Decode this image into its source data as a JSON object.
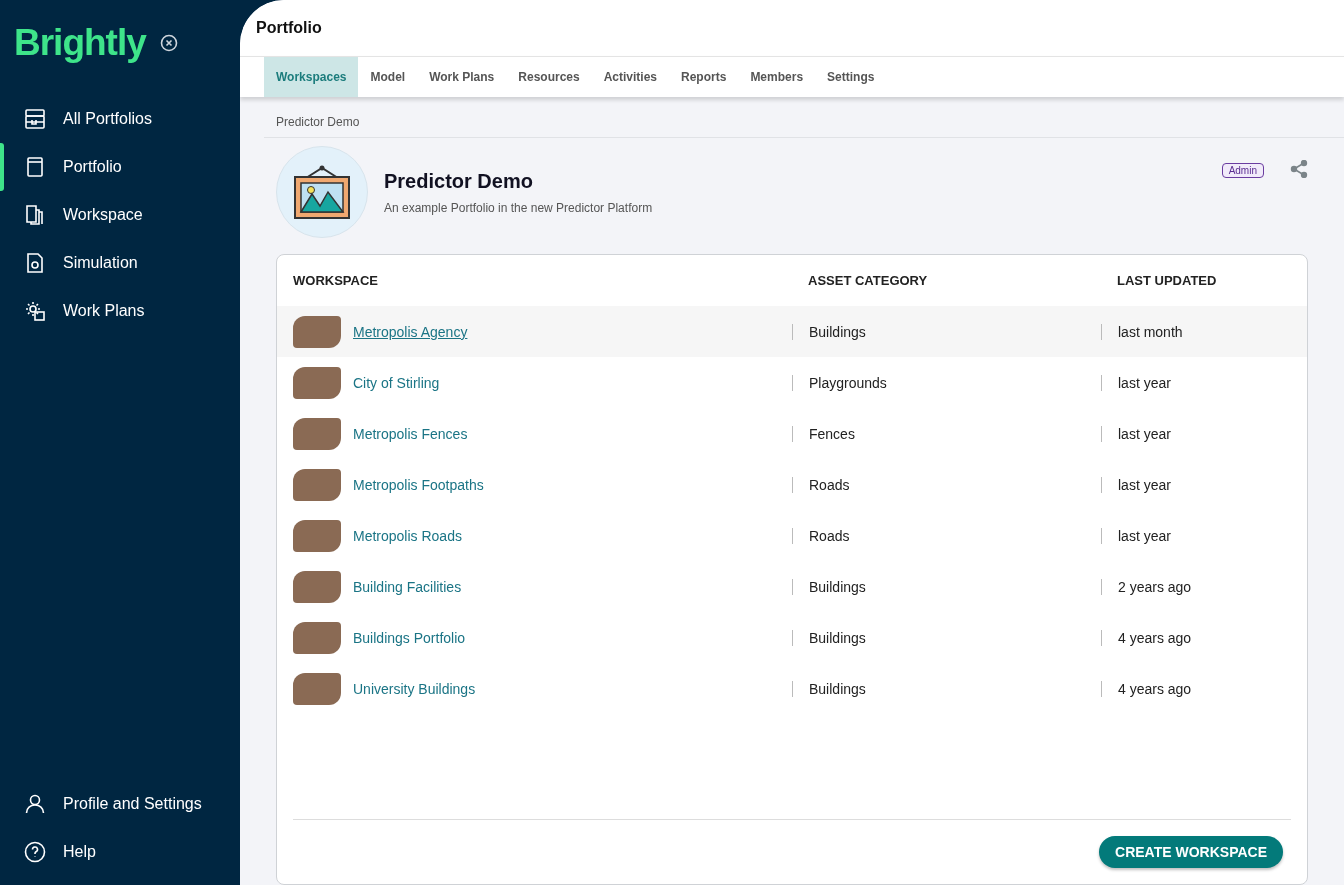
{
  "sidebar": {
    "logo": "Brightly",
    "items": [
      {
        "label": "All Portfolios",
        "selected": false
      },
      {
        "label": "Portfolio",
        "selected": true
      },
      {
        "label": "Workspace",
        "selected": false
      },
      {
        "label": "Simulation",
        "selected": false
      },
      {
        "label": "Work Plans",
        "selected": false
      }
    ],
    "bottom_items": [
      {
        "label": "Profile and Settings"
      },
      {
        "label": "Help"
      }
    ]
  },
  "header": {
    "title": "Portfolio"
  },
  "tabs": [
    {
      "label": "Workspaces",
      "selected": true
    },
    {
      "label": "Model",
      "selected": false
    },
    {
      "label": "Work Plans",
      "selected": false
    },
    {
      "label": "Resources",
      "selected": false
    },
    {
      "label": "Activities",
      "selected": false
    },
    {
      "label": "Reports",
      "selected": false
    },
    {
      "label": "Members",
      "selected": false
    },
    {
      "label": "Settings",
      "selected": false
    }
  ],
  "breadcrumb": "Predictor Demo",
  "portfolio": {
    "name": "Predictor Demo",
    "description": "An example Portfolio in the new Predictor Platform",
    "role": "Admin"
  },
  "table": {
    "columns": [
      "WORKSPACE",
      "ASSET CATEGORY",
      "LAST UPDATED"
    ],
    "rows": [
      {
        "name": "Metropolis Agency",
        "category": "Buildings",
        "updated": "last month",
        "highlighted": true
      },
      {
        "name": "City of Stirling",
        "category": "Playgrounds",
        "updated": "last year",
        "highlighted": false
      },
      {
        "name": "Metropolis Fences",
        "category": "Fences",
        "updated": "last year",
        "highlighted": false
      },
      {
        "name": "Metropolis Footpaths",
        "category": "Roads",
        "updated": "last year",
        "highlighted": false
      },
      {
        "name": "Metropolis Roads",
        "category": "Roads",
        "updated": "last year",
        "highlighted": false
      },
      {
        "name": "Building Facilities",
        "category": "Buildings",
        "updated": "2 years ago",
        "highlighted": false
      },
      {
        "name": "Buildings Portfolio",
        "category": "Buildings",
        "updated": "4 years ago",
        "highlighted": false
      },
      {
        "name": "University Buildings",
        "category": "Buildings",
        "updated": "4 years ago",
        "highlighted": false
      }
    ]
  },
  "create_button": "CREATE WORKSPACE"
}
